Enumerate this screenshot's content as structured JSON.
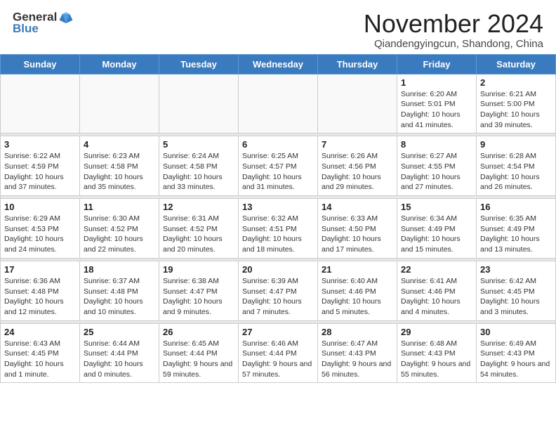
{
  "header": {
    "logo_line1": "General",
    "logo_line2": "Blue",
    "month_title": "November 2024",
    "location": "Qiandengyingcun, Shandong, China"
  },
  "weekdays": [
    "Sunday",
    "Monday",
    "Tuesday",
    "Wednesday",
    "Thursday",
    "Friday",
    "Saturday"
  ],
  "weeks": [
    [
      {
        "day": "",
        "info": ""
      },
      {
        "day": "",
        "info": ""
      },
      {
        "day": "",
        "info": ""
      },
      {
        "day": "",
        "info": ""
      },
      {
        "day": "",
        "info": ""
      },
      {
        "day": "1",
        "info": "Sunrise: 6:20 AM\nSunset: 5:01 PM\nDaylight: 10 hours and 41 minutes."
      },
      {
        "day": "2",
        "info": "Sunrise: 6:21 AM\nSunset: 5:00 PM\nDaylight: 10 hours and 39 minutes."
      }
    ],
    [
      {
        "day": "3",
        "info": "Sunrise: 6:22 AM\nSunset: 4:59 PM\nDaylight: 10 hours and 37 minutes."
      },
      {
        "day": "4",
        "info": "Sunrise: 6:23 AM\nSunset: 4:58 PM\nDaylight: 10 hours and 35 minutes."
      },
      {
        "day": "5",
        "info": "Sunrise: 6:24 AM\nSunset: 4:58 PM\nDaylight: 10 hours and 33 minutes."
      },
      {
        "day": "6",
        "info": "Sunrise: 6:25 AM\nSunset: 4:57 PM\nDaylight: 10 hours and 31 minutes."
      },
      {
        "day": "7",
        "info": "Sunrise: 6:26 AM\nSunset: 4:56 PM\nDaylight: 10 hours and 29 minutes."
      },
      {
        "day": "8",
        "info": "Sunrise: 6:27 AM\nSunset: 4:55 PM\nDaylight: 10 hours and 27 minutes."
      },
      {
        "day": "9",
        "info": "Sunrise: 6:28 AM\nSunset: 4:54 PM\nDaylight: 10 hours and 26 minutes."
      }
    ],
    [
      {
        "day": "10",
        "info": "Sunrise: 6:29 AM\nSunset: 4:53 PM\nDaylight: 10 hours and 24 minutes."
      },
      {
        "day": "11",
        "info": "Sunrise: 6:30 AM\nSunset: 4:52 PM\nDaylight: 10 hours and 22 minutes."
      },
      {
        "day": "12",
        "info": "Sunrise: 6:31 AM\nSunset: 4:52 PM\nDaylight: 10 hours and 20 minutes."
      },
      {
        "day": "13",
        "info": "Sunrise: 6:32 AM\nSunset: 4:51 PM\nDaylight: 10 hours and 18 minutes."
      },
      {
        "day": "14",
        "info": "Sunrise: 6:33 AM\nSunset: 4:50 PM\nDaylight: 10 hours and 17 minutes."
      },
      {
        "day": "15",
        "info": "Sunrise: 6:34 AM\nSunset: 4:49 PM\nDaylight: 10 hours and 15 minutes."
      },
      {
        "day": "16",
        "info": "Sunrise: 6:35 AM\nSunset: 4:49 PM\nDaylight: 10 hours and 13 minutes."
      }
    ],
    [
      {
        "day": "17",
        "info": "Sunrise: 6:36 AM\nSunset: 4:48 PM\nDaylight: 10 hours and 12 minutes."
      },
      {
        "day": "18",
        "info": "Sunrise: 6:37 AM\nSunset: 4:48 PM\nDaylight: 10 hours and 10 minutes."
      },
      {
        "day": "19",
        "info": "Sunrise: 6:38 AM\nSunset: 4:47 PM\nDaylight: 10 hours and 9 minutes."
      },
      {
        "day": "20",
        "info": "Sunrise: 6:39 AM\nSunset: 4:47 PM\nDaylight: 10 hours and 7 minutes."
      },
      {
        "day": "21",
        "info": "Sunrise: 6:40 AM\nSunset: 4:46 PM\nDaylight: 10 hours and 5 minutes."
      },
      {
        "day": "22",
        "info": "Sunrise: 6:41 AM\nSunset: 4:46 PM\nDaylight: 10 hours and 4 minutes."
      },
      {
        "day": "23",
        "info": "Sunrise: 6:42 AM\nSunset: 4:45 PM\nDaylight: 10 hours and 3 minutes."
      }
    ],
    [
      {
        "day": "24",
        "info": "Sunrise: 6:43 AM\nSunset: 4:45 PM\nDaylight: 10 hours and 1 minute."
      },
      {
        "day": "25",
        "info": "Sunrise: 6:44 AM\nSunset: 4:44 PM\nDaylight: 10 hours and 0 minutes."
      },
      {
        "day": "26",
        "info": "Sunrise: 6:45 AM\nSunset: 4:44 PM\nDaylight: 9 hours and 59 minutes."
      },
      {
        "day": "27",
        "info": "Sunrise: 6:46 AM\nSunset: 4:44 PM\nDaylight: 9 hours and 57 minutes."
      },
      {
        "day": "28",
        "info": "Sunrise: 6:47 AM\nSunset: 4:43 PM\nDaylight: 9 hours and 56 minutes."
      },
      {
        "day": "29",
        "info": "Sunrise: 6:48 AM\nSunset: 4:43 PM\nDaylight: 9 hours and 55 minutes."
      },
      {
        "day": "30",
        "info": "Sunrise: 6:49 AM\nSunset: 4:43 PM\nDaylight: 9 hours and 54 minutes."
      }
    ]
  ]
}
